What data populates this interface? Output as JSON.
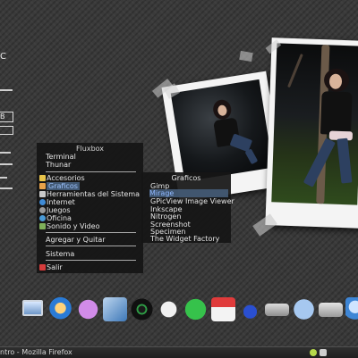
{
  "conky": {
    "top_text": "C",
    "box_label_1": "B"
  },
  "fluxbox_menu": {
    "title": "Fluxbox",
    "items": [
      {
        "label": "Terminal",
        "icon": "terminal-icon"
      },
      {
        "label": "Thunar",
        "icon": "file-manager-icon"
      },
      {
        "label": "Accesorios",
        "icon": "accessories-icon"
      },
      {
        "label": "Graficos",
        "icon": "graphics-icon"
      },
      {
        "label": "Herramientas del Sistema",
        "icon": "system-tools-icon"
      },
      {
        "label": "Internet",
        "icon": "internet-icon"
      },
      {
        "label": "Juegos",
        "icon": "games-icon"
      },
      {
        "label": "Oficina",
        "icon": "office-icon"
      },
      {
        "label": "Sonido y Video",
        "icon": "multimedia-icon"
      },
      {
        "label": "Agregar y Quitar"
      },
      {
        "label": "Sistema"
      },
      {
        "label": "Salir",
        "icon": "exit-icon"
      }
    ]
  },
  "graphics_submenu": {
    "title": "Graficos",
    "items": [
      "Gimp",
      "Mirage",
      "GPicView Image Viewer",
      "Inkscape",
      "Nitrogen",
      "Screenshot",
      "Specimen",
      "The Widget Factory"
    ]
  },
  "dock": {
    "icons": [
      "computer-icon",
      "network-icon",
      "chat-icon",
      "image-viewer-icon",
      "media-disc-icon",
      "gamepad-icon",
      "play-icon",
      "calendar-icon",
      "gnome-foot-icon",
      "terminal-icon",
      "network-globe-icon",
      "drive-icon",
      "web-browser-icon"
    ]
  },
  "taskbar": {
    "window_title": "ntro - Mozilla Firefox"
  }
}
